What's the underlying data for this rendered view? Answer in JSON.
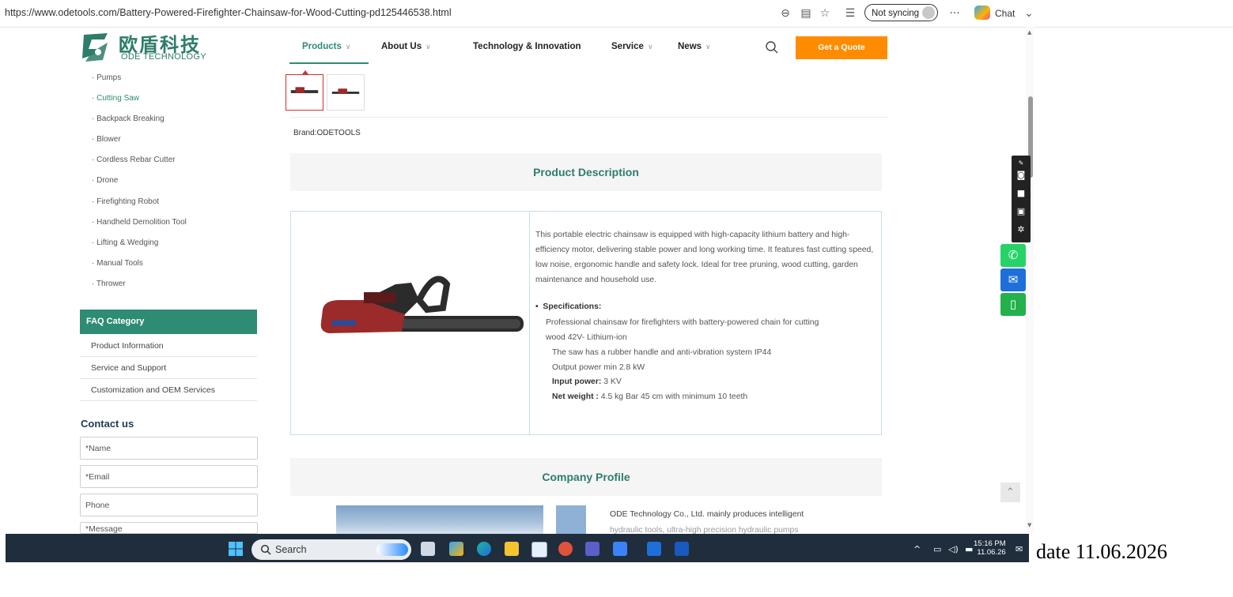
{
  "browser": {
    "url": "https://www.odetools.com/Battery-Powered-Firefighter-Chainsaw-for-Wood-Cutting-pd125446538.html",
    "sync_label": "Not syncing",
    "more_label": "···",
    "chat_label": "Chat"
  },
  "site": {
    "logo_cn": "欧盾科技",
    "logo_en": "ODE TECHNOLOGY",
    "nav": [
      {
        "label": "Products"
      },
      {
        "label": "About Us"
      },
      {
        "label": "Technology & Innovation"
      },
      {
        "label": "Service"
      },
      {
        "label": "News"
      }
    ],
    "quote_label": "Get a Quote"
  },
  "sidebar": {
    "categories": [
      "· Pumps",
      "· Cutting Saw",
      "· Backpack Breaking",
      "· Blower",
      "· Cordless Rebar Cutter",
      "· Drone",
      "· Firefighting Robot",
      "· Handheld Demolition Tool",
      "· Lifting & Wedging",
      "· Manual Tools",
      "· Thrower"
    ],
    "active_category": "· Cutting Saw",
    "faq_title": "FAQ Category",
    "faq_items": [
      "Product Information",
      "Service and Support",
      "Customization and OEM Services"
    ],
    "contact_title": "Contact us",
    "contact_fields": [
      "*Name",
      "*Email",
      "Phone",
      "*Message"
    ]
  },
  "product": {
    "brand": "Brand:ODETOOLS",
    "desc_title": "Product Description",
    "desc_paragraph": "This portable electric chainsaw is equipped with high-capacity lithium battery and high-efficiency motor, delivering stable power and long working time. It features fast cutting speed, low noise, ergonomic handle and safety lock. Ideal for tree pruning, wood cutting, garden maintenance and household use.",
    "spec_heading": "Specifications:",
    "spec_line1": "Professional chainsaw for firefighters with battery-powered chain for cutting",
    "spec_line2": "wood 42V- Lithium-ion",
    "spec_line3": "The saw has a rubber handle and anti-vibration system IP44",
    "spec_line4": "Output power min 2.8 kW",
    "spec_input_label": "Input power:",
    "spec_input_value": " 3 KV",
    "spec_weight_label": "Net weight :",
    "spec_weight_value": " 4.5 kg Bar 45 cm with minimum 10 teeth",
    "company_title": "Company Profile",
    "company_text": "ODE Technology Co., Ltd. mainly produces intelligent",
    "company_text2": "hydraulic tools, ultra-high precision hydraulic pumps"
  },
  "taskbar": {
    "search_placeholder": "Search",
    "time": "15:16 PM",
    "date": "11.06.26"
  },
  "overlay_date": "date 11.06.2026",
  "colors": {
    "brand_green": "#2e8b74",
    "quote_orange": "#ff8c00",
    "whatsapp": "#25d366",
    "email_blue": "#1e6fd9"
  }
}
